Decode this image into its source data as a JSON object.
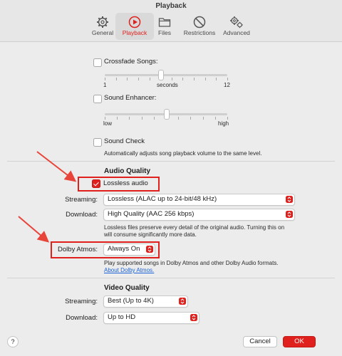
{
  "window": {
    "title": "Playback"
  },
  "tabs": [
    {
      "label": "General",
      "icon": "gear-icon"
    },
    {
      "label": "Playback",
      "icon": "play-circle-icon",
      "active": true
    },
    {
      "label": "Files",
      "icon": "folder-icon"
    },
    {
      "label": "Restrictions",
      "icon": "restrictions-icon"
    },
    {
      "label": "Advanced",
      "icon": "advanced-gears-icon"
    }
  ],
  "crossfade": {
    "label": "Crossfade Songs:",
    "checked": false,
    "min": "1",
    "unit": "seconds",
    "max": "12",
    "value": 6
  },
  "enhancer": {
    "label": "Sound Enhancer:",
    "checked": false,
    "min": "low",
    "max": "high",
    "value": 0.5
  },
  "soundcheck": {
    "label": "Sound Check",
    "checked": false,
    "desc": "Automatically adjusts song playback volume to the same level."
  },
  "audio_quality": {
    "heading": "Audio Quality",
    "lossless": {
      "label": "Lossless audio",
      "checked": true
    },
    "streaming_label": "Streaming:",
    "streaming_value": "Lossless (ALAC up to 24-bit/48 kHz)",
    "download_label": "Download:",
    "download_value": "High Quality (AAC 256 kbps)",
    "desc_line1": "Lossless files preserve every detail of the original audio. Turning this on",
    "desc_line2": "will consume significantly more data.",
    "dolby_label": "Dolby Atmos:",
    "dolby_value": "Always On",
    "dolby_desc": "Play supported songs in Dolby Atmos and other Dolby Audio formats.",
    "dolby_link": "About Dolby Atmos."
  },
  "video_quality": {
    "heading": "Video Quality",
    "streaming_label": "Streaming:",
    "streaming_value": "Best (Up to 4K)",
    "download_label": "Download:",
    "download_value": "Up to HD"
  },
  "footer": {
    "help": "?",
    "cancel": "Cancel",
    "ok": "OK"
  },
  "colors": {
    "accent": "#e0201c",
    "link": "#1a62d6",
    "background": "#ececec"
  }
}
